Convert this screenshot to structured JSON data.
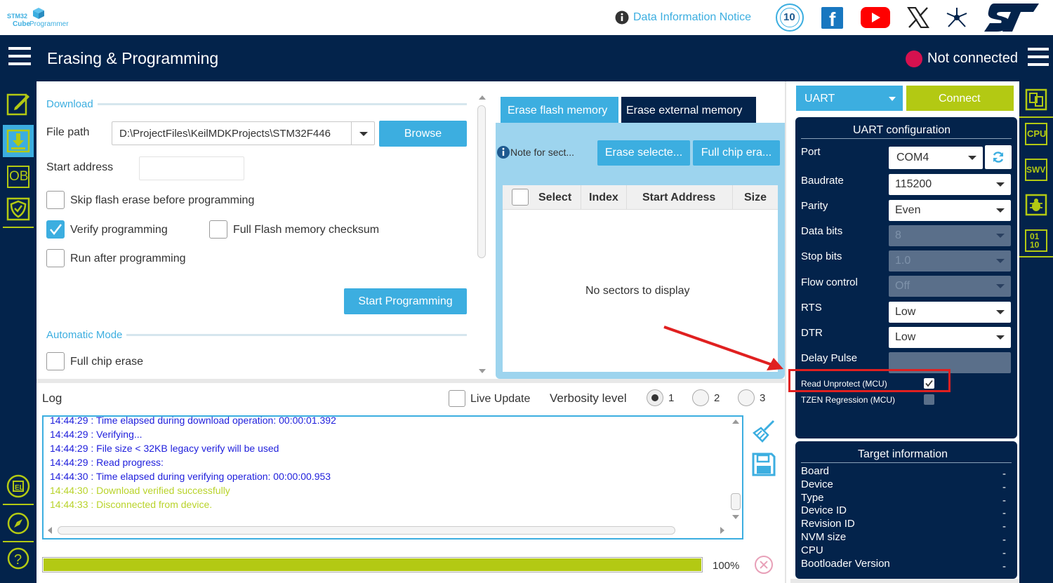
{
  "topbar": {
    "logo_line1": "STM32",
    "logo_line2a": "Cube",
    "logo_line2b": "Programmer",
    "notice_label": "Data Information Notice",
    "anniversary_badge": "10",
    "icons": [
      "info-icon",
      "anniversary-badge-icon",
      "facebook-icon",
      "youtube-icon",
      "x-icon",
      "network-icon",
      "st-logo-icon"
    ]
  },
  "header": {
    "title": "Erasing & Programming",
    "status": "Not connected",
    "status_color": "#d6114f"
  },
  "leftnav": {
    "ob_label": "OB",
    "icons": [
      "edit-icon",
      "download-icon",
      "ob-icon",
      "shield-icon",
      "el-icon",
      "compass-icon",
      "help-icon"
    ]
  },
  "download": {
    "section_title": "Download",
    "file_path_label": "File path",
    "file_path_value": "D:\\ProjectFiles\\KeilMDKProjects\\STM32F446",
    "browse_label": "Browse",
    "start_address_label": "Start address",
    "start_address_value": "",
    "skip_erase_label": "Skip flash erase before programming",
    "skip_erase_checked": false,
    "verify_label": "Verify programming",
    "verify_checked": true,
    "checksum_label": "Full Flash memory checksum",
    "checksum_checked": false,
    "run_after_label": "Run after programming",
    "run_after_checked": false,
    "start_programming_label": "Start Programming",
    "auto_mode_title": "Automatic Mode",
    "full_chip_erase_label": "Full chip erase",
    "full_chip_erase_checked": false
  },
  "erase": {
    "tab_flash": "Erase flash memory",
    "tab_external": "Erase external memory",
    "note_label": "Note for sect...",
    "erase_selected_label": "Erase selecte...",
    "full_chip_label": "Full chip era...",
    "columns": [
      "Select",
      "Index",
      "Start Address",
      "Size"
    ],
    "empty_message": "No sectors to display"
  },
  "log": {
    "title": "Log",
    "live_update_label": "Live Update",
    "live_update_checked": false,
    "verbosity_label": "Verbosity level",
    "verbosity_options": [
      "1",
      "2",
      "3"
    ],
    "verbosity_selected": "1",
    "lines": [
      {
        "text": "14:44:29 : Time elapsed during download operation: 00:00:01.392",
        "color": "#1e1edc"
      },
      {
        "text": "14:44:29 : Verifying...",
        "color": "#1e1edc"
      },
      {
        "text": "14:44:29 : File size < 32KB legacy verify will be used",
        "color": "#1e1edc"
      },
      {
        "text": "14:44:29 : Read progress:",
        "color": "#1e1edc"
      },
      {
        "text": "14:44:30 : Time elapsed during verifying operation: 00:00:00.953",
        "color": "#1e1edc"
      },
      {
        "text": "14:44:30 : Download verified successfully",
        "color": "#b9d32a"
      },
      {
        "text": "14:44:33 : Disconnected from device.",
        "color": "#b9d32a"
      }
    ],
    "icons": [
      "broom-icon",
      "save-icon"
    ]
  },
  "progress": {
    "value_percent": 100,
    "label": "100%",
    "fill_color": "#b3c913"
  },
  "connection": {
    "interface": "UART",
    "connect_label": "Connect",
    "connect_color": "#b3c913"
  },
  "uart_config": {
    "title": "UART configuration",
    "port_label": "Port",
    "port_value": "COM4",
    "baudrate_label": "Baudrate",
    "baudrate_value": "115200",
    "parity_label": "Parity",
    "parity_value": "Even",
    "data_bits_label": "Data bits",
    "data_bits_value": "8",
    "stop_bits_label": "Stop bits",
    "stop_bits_value": "1.0",
    "flow_control_label": "Flow control",
    "flow_control_value": "Off",
    "rts_label": "RTS",
    "rts_value": "Low",
    "dtr_label": "DTR",
    "dtr_value": "Low",
    "delay_pulse_label": "Delay Pulse",
    "delay_pulse_value": "",
    "read_unprotect_label": "Read Unprotect (MCU)",
    "read_unprotect_checked": true,
    "tzen_label": "TZEN Regression (MCU)",
    "tzen_checked": false
  },
  "target_info": {
    "title": "Target information",
    "rows": [
      {
        "label": "Board",
        "value": "-"
      },
      {
        "label": "Device",
        "value": "-"
      },
      {
        "label": "Type",
        "value": "-"
      },
      {
        "label": "Device ID",
        "value": "-"
      },
      {
        "label": "Revision ID",
        "value": "-"
      },
      {
        "label": "NVM size",
        "value": "-"
      },
      {
        "label": "CPU",
        "value": "-"
      },
      {
        "label": "Bootloader Version",
        "value": "-"
      }
    ]
  },
  "rightnav": {
    "cpu_label": "CPU",
    "swv_label": "SWV",
    "binary_label": "01\n10",
    "icons": [
      "compare-icon",
      "cpu-icon",
      "swv-icon",
      "bug-icon",
      "binary-icon"
    ]
  },
  "annotation": {
    "highlight_color": "#e02020"
  }
}
